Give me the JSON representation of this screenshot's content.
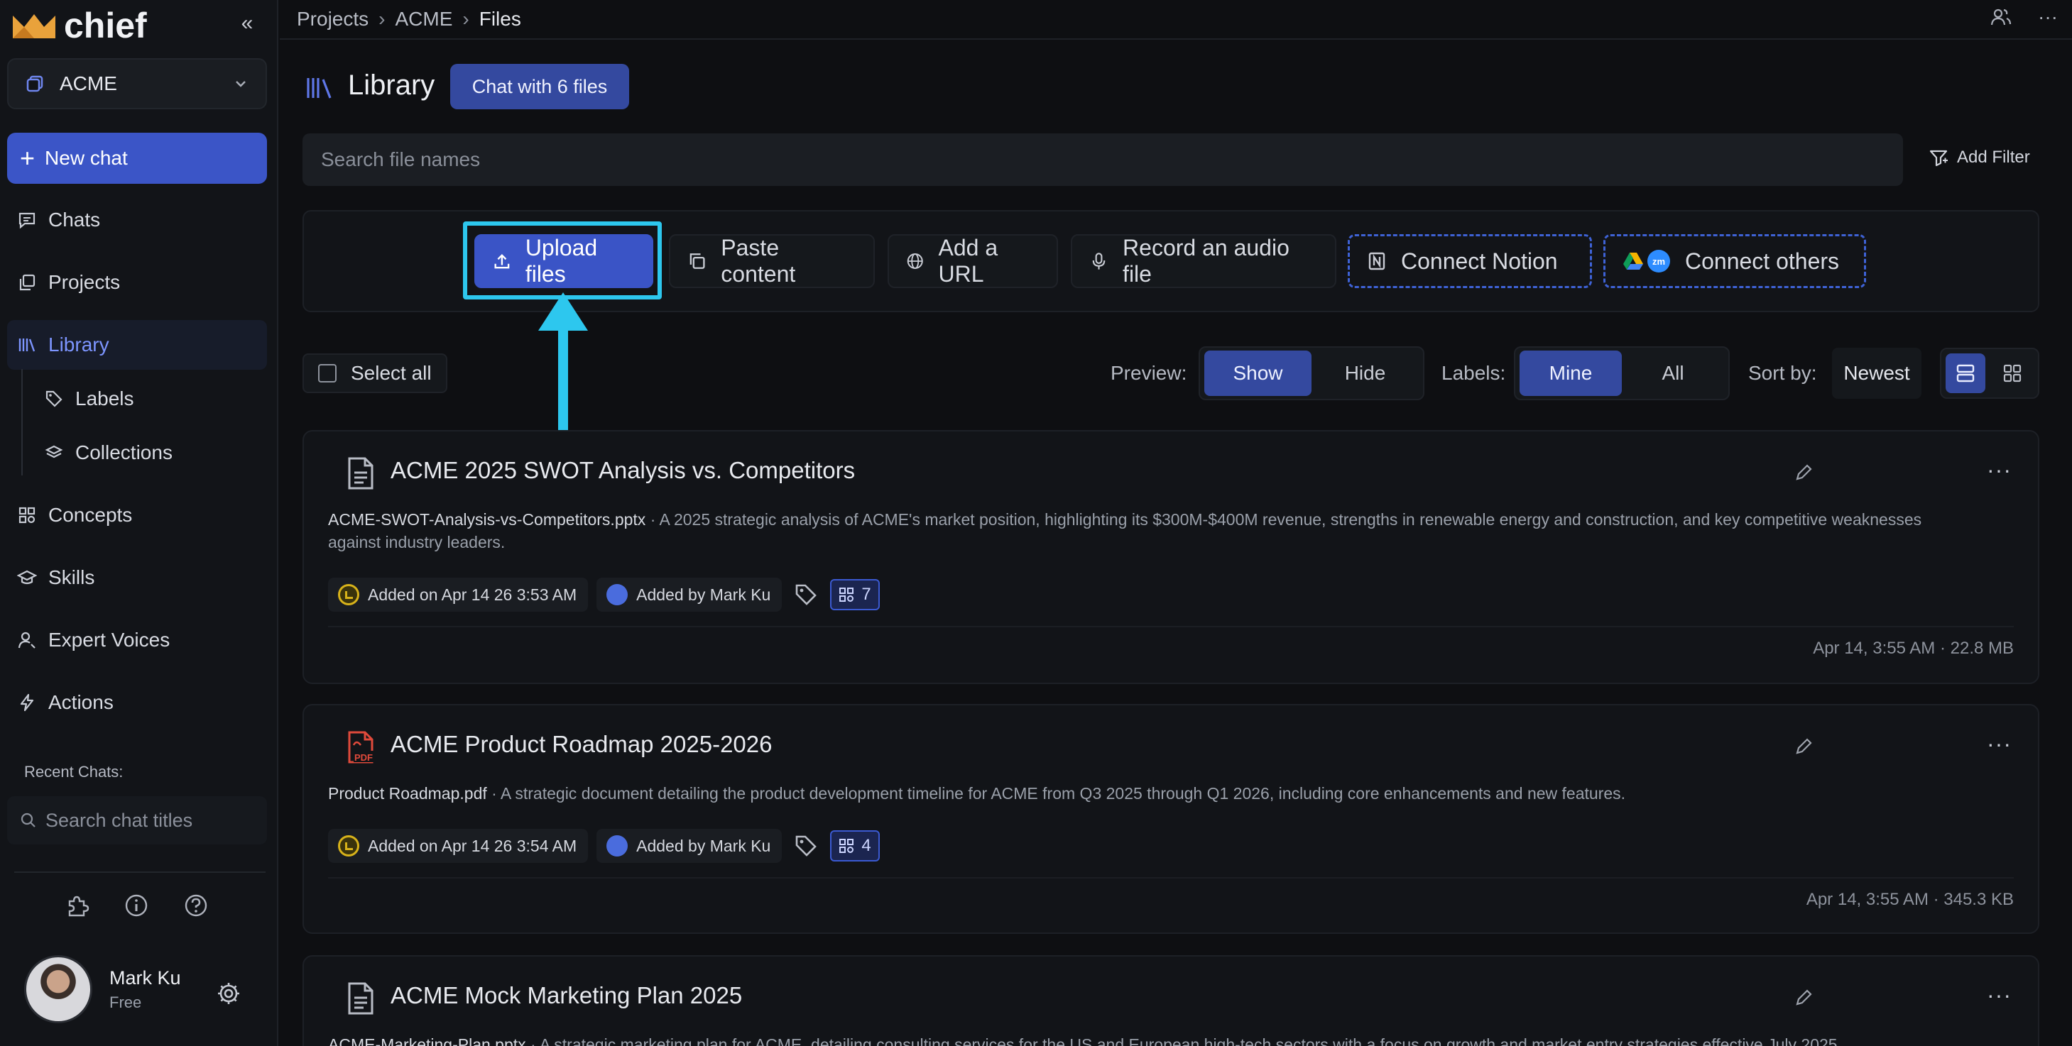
{
  "app": {
    "logo_text": "chief",
    "collapse_glyph": "«"
  },
  "workspace": {
    "name": "ACME"
  },
  "sidebar": {
    "new_chat": "New chat",
    "items": [
      {
        "label": "Chats",
        "icon": "chat-icon"
      },
      {
        "label": "Projects",
        "icon": "projects-icon"
      },
      {
        "label": "Library",
        "icon": "library-icon",
        "active": true
      },
      {
        "label": "Labels",
        "icon": "tag-icon"
      },
      {
        "label": "Collections",
        "icon": "layers-icon"
      },
      {
        "label": "Concepts",
        "icon": "concepts-icon"
      },
      {
        "label": "Skills",
        "icon": "graduation-cap-icon"
      },
      {
        "label": "Expert Voices",
        "icon": "person-voice-icon"
      },
      {
        "label": "Actions",
        "icon": "lightning-icon"
      }
    ],
    "recent_label": "Recent Chats:",
    "search_placeholder": "Search chat titles"
  },
  "user": {
    "name": "Mark Ku",
    "plan": "Free"
  },
  "breadcrumb": {
    "items": [
      "Projects",
      "ACME"
    ],
    "current": "Files"
  },
  "library": {
    "title": "Library",
    "chat_button": "Chat with 6 files",
    "search_placeholder": "Search file names",
    "add_filter": "Add Filter"
  },
  "actions": {
    "upload": "Upload files",
    "paste": "Paste content",
    "url": "Add a URL",
    "record": "Record an audio file",
    "notion": "Connect Notion",
    "others": "Connect others"
  },
  "controls": {
    "select_all": "Select all",
    "preview_label": "Preview:",
    "preview_options": [
      "Show",
      "Hide"
    ],
    "preview_selected": "Show",
    "labels_label": "Labels:",
    "labels_options": [
      "Mine",
      "All"
    ],
    "labels_selected": "Mine",
    "sort_label": "Sort by:",
    "sort_value": "Newest"
  },
  "files": [
    {
      "title": "ACME 2025 SWOT Analysis vs. Competitors",
      "icon": "document-icon",
      "filename": "ACME-SWOT-Analysis-vs-Competitors.pptx",
      "description": " · A 2025 strategic analysis of ACME's market position, highlighting its $300M-$400M revenue, strengths in renewable energy and construction, and key competitive weaknesses against industry leaders.",
      "added_on": "Added on Apr 14 26 3:53 AM",
      "added_by": "Added by Mark Ku",
      "count": "7",
      "meta": "Apr 14, 3:55 AM · 22.8 MB"
    },
    {
      "title": "ACME Product Roadmap 2025-2026",
      "icon": "pdf-icon",
      "filename": "Product Roadmap.pdf",
      "description": " · A strategic document detailing the product development timeline for ACME from Q3 2025 through Q1 2026, including core enhancements and new features.",
      "added_on": "Added on Apr 14 26 3:54 AM",
      "added_by": "Added by Mark Ku",
      "count": "4",
      "meta": "Apr 14, 3:55 AM · 345.3 KB"
    },
    {
      "title": "ACME Mock Marketing Plan 2025",
      "icon": "document-icon",
      "filename": "ACME-Marketing-Plan.pptx",
      "description": " · A strategic marketing plan for ACME, detailing consulting services for the US and European high-tech sectors with a focus on growth and market entry strategies effective July 2025."
    }
  ],
  "colors": {
    "accent": "#3b55c7",
    "highlight": "#2dc7ee",
    "background": "#0e0f12"
  }
}
